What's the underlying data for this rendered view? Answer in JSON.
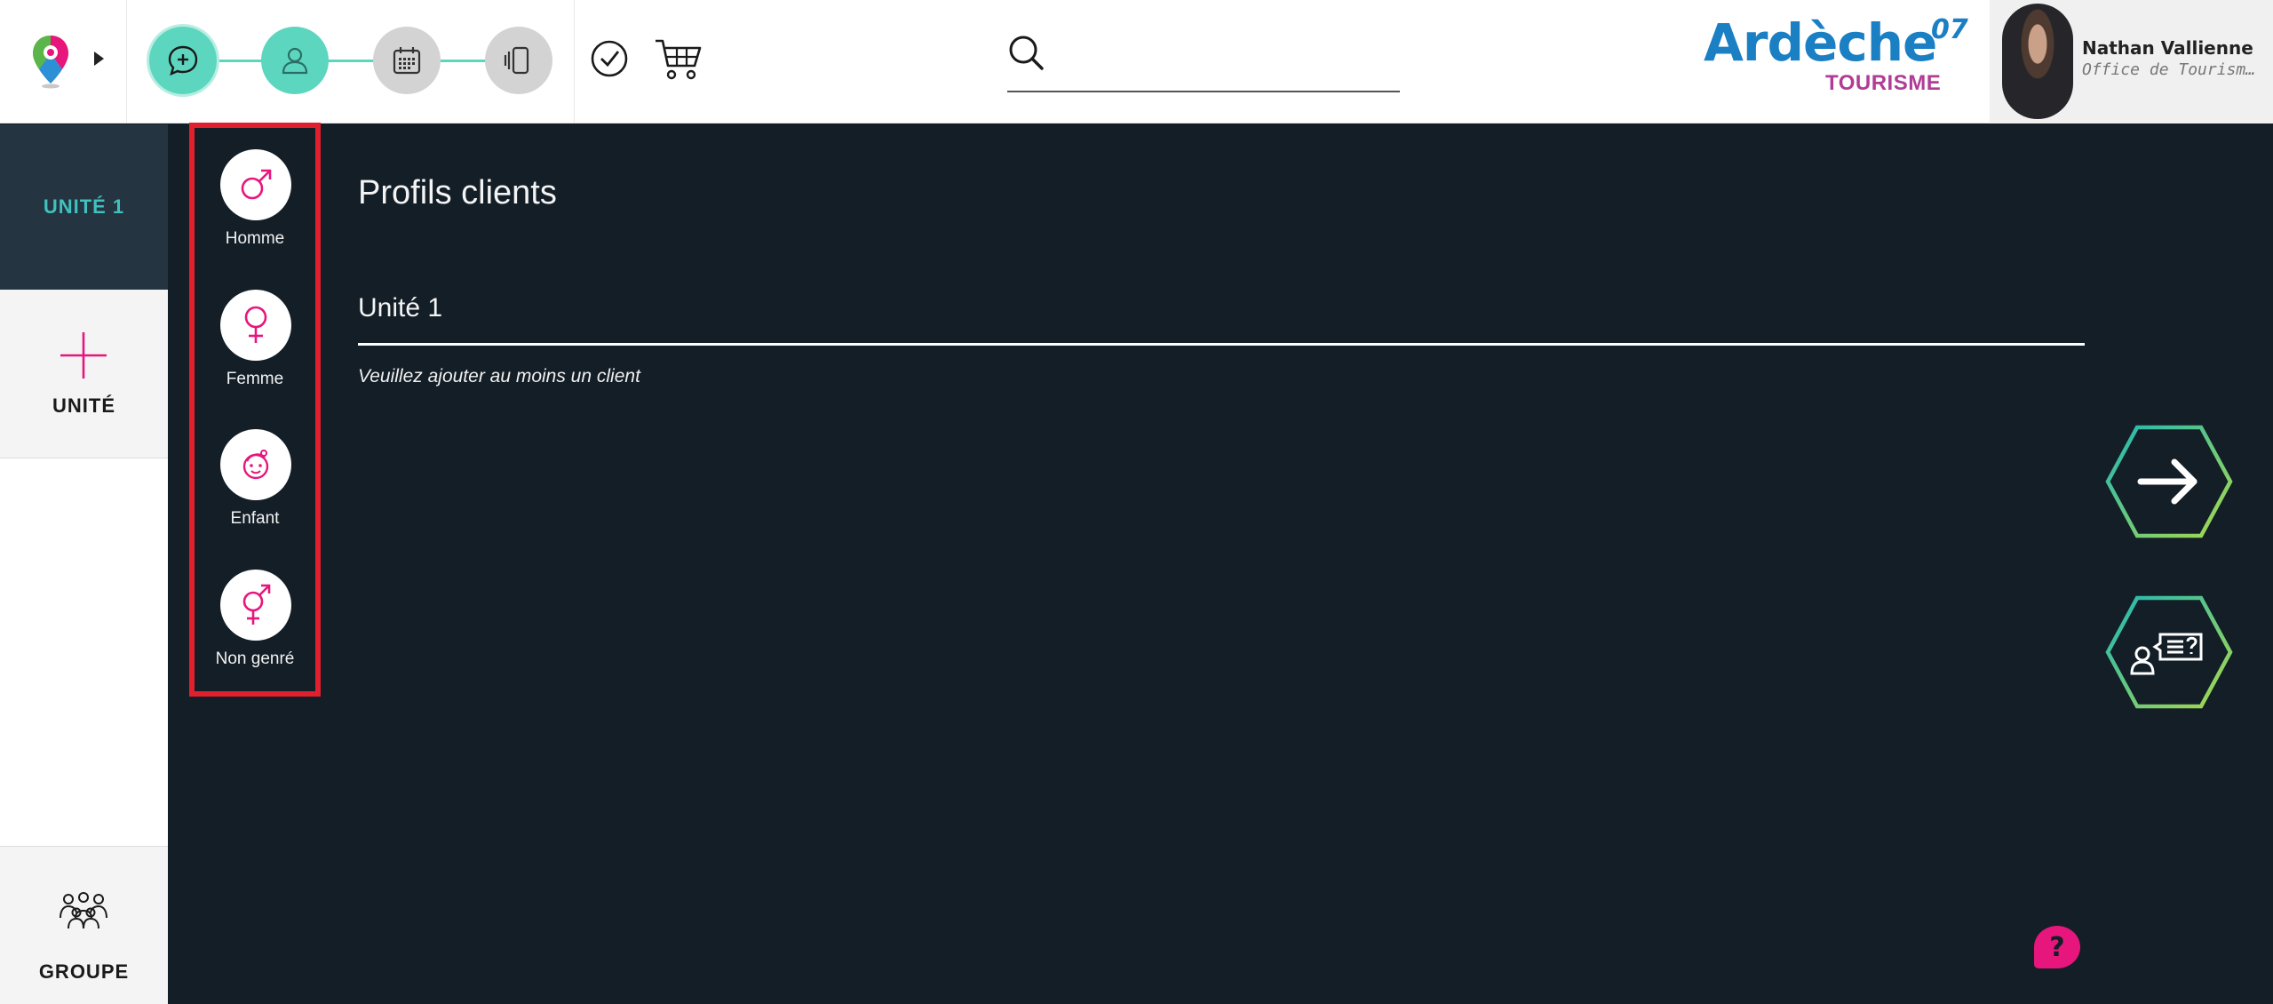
{
  "header": {
    "search": {
      "placeholder": "",
      "value": ""
    },
    "brand": {
      "name": "Ardèche",
      "superscript": "07",
      "subtitle": "TOURISME"
    },
    "user": {
      "name": "Nathan Vallienne",
      "organization": "Office de Tourisme Ardèche"
    },
    "steps": [
      {
        "icon": "chat-plus-icon",
        "state": "active"
      },
      {
        "icon": "user-icon",
        "state": "done"
      },
      {
        "icon": "calendar-icon",
        "state": "todo"
      },
      {
        "icon": "cards-icon",
        "state": "todo"
      }
    ]
  },
  "sidebar": {
    "unit_tab": "UNITÉ 1",
    "add_unit": "UNITÉ",
    "group": "GROUPE"
  },
  "profiles": [
    {
      "label": "Homme",
      "icon": "male-symbol-icon"
    },
    {
      "label": "Femme",
      "icon": "female-symbol-icon"
    },
    {
      "label": "Enfant",
      "icon": "child-face-icon"
    },
    {
      "label": "Non genré",
      "icon": "gender-neutral-icon"
    }
  ],
  "main": {
    "title": "Profils clients",
    "unit_heading": "Unité 1",
    "empty_message": "Veuillez ajouter au moins un client"
  },
  "colors": {
    "background": "#131e27",
    "accent_teal": "#5dd6bf",
    "accent_pink": "#e6167d",
    "brand_blue": "#1b7fc4",
    "brand_purple": "#b03c96",
    "highlight_red": "#e0202d"
  }
}
